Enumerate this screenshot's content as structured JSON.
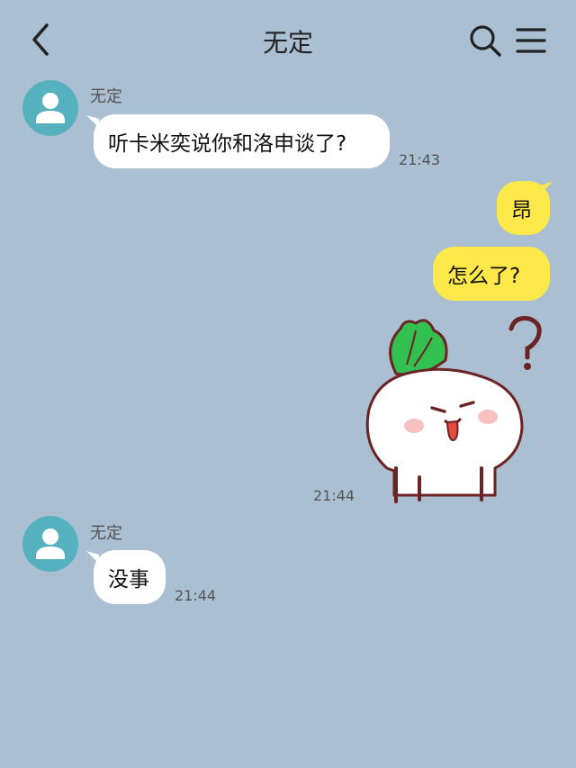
{
  "header": {
    "title": "无定",
    "back_icon": "chevron-left-icon",
    "search_icon": "search-icon",
    "menu_icon": "menu-icon"
  },
  "messages": [
    {
      "sender": "无定",
      "text": "听卡米奕说你和洛申谈了?",
      "time": "21:43",
      "side": "left"
    },
    {
      "text": "昂",
      "side": "right"
    },
    {
      "text": "怎么了?",
      "side": "right"
    },
    {
      "type": "sticker",
      "sticker": "radish-confused-sticker",
      "time": "21:44",
      "side": "right"
    },
    {
      "sender": "无定",
      "text": "没事",
      "time": "21:44",
      "side": "left"
    }
  ],
  "colors": {
    "background": "#aabfd2",
    "incoming_bubble": "#ffffff",
    "outgoing_bubble": "#fde84a",
    "avatar": "#56b1bf"
  }
}
